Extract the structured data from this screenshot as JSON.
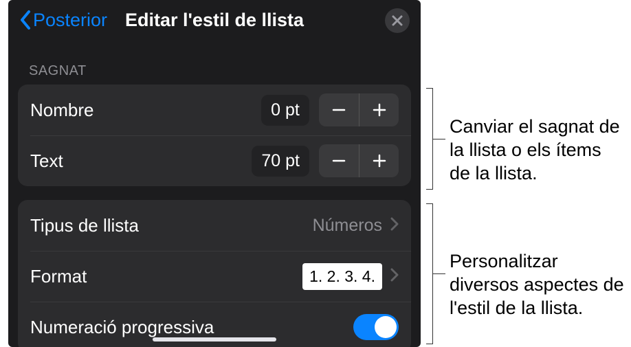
{
  "header": {
    "back_label": "Posterior",
    "title": "Editar l'estil de llista"
  },
  "sections": {
    "sagnat": {
      "label": "SAGNAT",
      "nombre": {
        "label": "Nombre",
        "value": "0 pt"
      },
      "text": {
        "label": "Text",
        "value": "70 pt"
      }
    },
    "style": {
      "tipus": {
        "label": "Tipus de llista",
        "value": "Números"
      },
      "format": {
        "label": "Format",
        "value": "1. 2. 3. 4."
      },
      "numprog": {
        "label": "Numeració progressiva",
        "on": true
      }
    }
  },
  "callouts": {
    "c1": "Canviar el sagnat de la llista o els ítems de la llista.",
    "c2": "Personalitzar diversos aspectes de l'estil de la llista."
  }
}
